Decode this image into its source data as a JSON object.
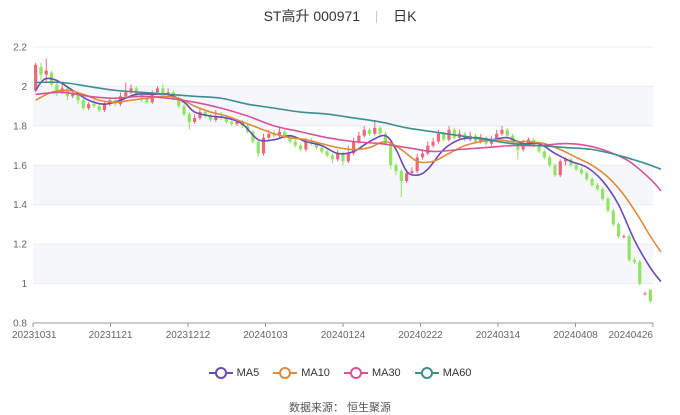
{
  "title": {
    "name": "ST高升 000971",
    "period": "日K"
  },
  "source": "数据来源： 恒生聚源",
  "colors": {
    "up": "#f0657a",
    "down": "#8ee55f",
    "grid": "#e8ecf4",
    "band": "#f5f7fb"
  },
  "chart_data": {
    "type": "candlestick",
    "ylim": [
      0.8,
      2.2
    ],
    "yticks": [
      "0.8",
      "1",
      "1.2",
      "1.4",
      "1.6",
      "1.8",
      "2",
      "2.2"
    ],
    "xticks": [
      "20231031",
      "20231121",
      "20231212",
      "20240103",
      "20240124",
      "20240222",
      "20240314",
      "20240408",
      "20240426"
    ],
    "legend_position": "bottom",
    "grid": true,
    "candles": [
      [
        1.98,
        2.11,
        2.12,
        1.97
      ],
      [
        2.1,
        2.06,
        2.12,
        2.03
      ],
      [
        2.06,
        2.08,
        2.14,
        2.02
      ],
      [
        2.07,
        2.01,
        2.08,
        2.0
      ],
      [
        2.01,
        1.97,
        2.02,
        1.95
      ],
      [
        1.97,
        1.99,
        2.01,
        1.96
      ],
      [
        1.99,
        1.95,
        2.0,
        1.93
      ],
      [
        1.95,
        1.96,
        1.98,
        1.94
      ],
      [
        1.96,
        1.93,
        1.97,
        1.91
      ],
      [
        1.93,
        1.89,
        1.94,
        1.88
      ],
      [
        1.89,
        1.91,
        1.92,
        1.88
      ],
      [
        1.91,
        1.9,
        1.94,
        1.89
      ],
      [
        1.9,
        1.88,
        1.91,
        1.87
      ],
      [
        1.88,
        1.91,
        1.92,
        1.87
      ],
      [
        1.91,
        1.93,
        1.94,
        1.9
      ],
      [
        1.93,
        1.91,
        1.94,
        1.9
      ],
      [
        1.91,
        1.95,
        1.97,
        1.9
      ],
      [
        1.95,
        1.97,
        2.02,
        1.94
      ],
      [
        1.97,
        1.99,
        2.01,
        1.96
      ],
      [
        1.99,
        1.96,
        2.0,
        1.95
      ],
      [
        1.96,
        1.94,
        1.97,
        1.92
      ],
      [
        1.94,
        1.92,
        1.95,
        1.91
      ],
      [
        1.92,
        1.97,
        1.98,
        1.91
      ],
      [
        1.97,
        1.99,
        2.0,
        1.96
      ],
      [
        1.99,
        1.96,
        2.01,
        1.95
      ],
      [
        1.96,
        1.97,
        1.99,
        1.95
      ],
      [
        1.97,
        1.94,
        1.98,
        1.93
      ],
      [
        1.94,
        1.9,
        1.95,
        1.89
      ],
      [
        1.9,
        1.86,
        1.91,
        1.85
      ],
      [
        1.86,
        1.82,
        1.87,
        1.78
      ],
      [
        1.82,
        1.84,
        1.86,
        1.81
      ],
      [
        1.84,
        1.87,
        1.89,
        1.83
      ],
      [
        1.87,
        1.85,
        1.88,
        1.84
      ],
      [
        1.85,
        1.83,
        1.86,
        1.82
      ],
      [
        1.83,
        1.85,
        1.88,
        1.82
      ],
      [
        1.85,
        1.84,
        1.87,
        1.83
      ],
      [
        1.84,
        1.82,
        1.85,
        1.81
      ],
      [
        1.82,
        1.81,
        1.84,
        1.8
      ],
      [
        1.81,
        1.82,
        1.83,
        1.8
      ],
      [
        1.82,
        1.8,
        1.83,
        1.79
      ],
      [
        1.8,
        1.77,
        1.81,
        1.76
      ],
      [
        1.77,
        1.72,
        1.78,
        1.71
      ],
      [
        1.72,
        1.66,
        1.73,
        1.64
      ],
      [
        1.66,
        1.74,
        1.76,
        1.65
      ],
      [
        1.74,
        1.76,
        1.78,
        1.73
      ],
      [
        1.76,
        1.75,
        1.78,
        1.74
      ],
      [
        1.75,
        1.77,
        1.79,
        1.74
      ],
      [
        1.77,
        1.74,
        1.78,
        1.73
      ],
      [
        1.74,
        1.72,
        1.75,
        1.71
      ],
      [
        1.72,
        1.7,
        1.73,
        1.69
      ],
      [
        1.7,
        1.68,
        1.71,
        1.67
      ],
      [
        1.68,
        1.72,
        1.74,
        1.67
      ],
      [
        1.72,
        1.71,
        1.74,
        1.7
      ],
      [
        1.71,
        1.69,
        1.72,
        1.68
      ],
      [
        1.69,
        1.67,
        1.7,
        1.66
      ],
      [
        1.67,
        1.65,
        1.68,
        1.64
      ],
      [
        1.65,
        1.63,
        1.66,
        1.61
      ],
      [
        1.63,
        1.66,
        1.68,
        1.62
      ],
      [
        1.66,
        1.62,
        1.67,
        1.6
      ],
      [
        1.62,
        1.66,
        1.7,
        1.61
      ],
      [
        1.66,
        1.72,
        1.74,
        1.65
      ],
      [
        1.72,
        1.75,
        1.77,
        1.71
      ],
      [
        1.75,
        1.78,
        1.8,
        1.74
      ],
      [
        1.78,
        1.76,
        1.79,
        1.75
      ],
      [
        1.76,
        1.79,
        1.83,
        1.75
      ],
      [
        1.79,
        1.76,
        1.8,
        1.74
      ],
      [
        1.76,
        1.71,
        1.77,
        1.7
      ],
      [
        1.71,
        1.6,
        1.72,
        1.58
      ],
      [
        1.6,
        1.57,
        1.61,
        1.55
      ],
      [
        1.57,
        1.52,
        1.58,
        1.44
      ],
      [
        1.52,
        1.56,
        1.58,
        1.51
      ],
      [
        1.56,
        1.57,
        1.59,
        1.55
      ],
      [
        1.57,
        1.64,
        1.66,
        1.56
      ],
      [
        1.64,
        1.66,
        1.68,
        1.63
      ],
      [
        1.66,
        1.7,
        1.72,
        1.65
      ],
      [
        1.7,
        1.72,
        1.74,
        1.69
      ],
      [
        1.72,
        1.76,
        1.78,
        1.71
      ],
      [
        1.76,
        1.73,
        1.77,
        1.72
      ],
      [
        1.73,
        1.78,
        1.8,
        1.72
      ],
      [
        1.78,
        1.74,
        1.79,
        1.73
      ],
      [
        1.74,
        1.76,
        1.78,
        1.73
      ],
      [
        1.76,
        1.73,
        1.77,
        1.72
      ],
      [
        1.73,
        1.75,
        1.77,
        1.72
      ],
      [
        1.75,
        1.72,
        1.76,
        1.71
      ],
      [
        1.72,
        1.74,
        1.76,
        1.71
      ],
      [
        1.74,
        1.71,
        1.75,
        1.7
      ],
      [
        1.71,
        1.73,
        1.75,
        1.7
      ],
      [
        1.73,
        1.76,
        1.78,
        1.72
      ],
      [
        1.76,
        1.78,
        1.8,
        1.75
      ],
      [
        1.78,
        1.75,
        1.79,
        1.74
      ],
      [
        1.75,
        1.72,
        1.76,
        1.71
      ],
      [
        1.72,
        1.68,
        1.73,
        1.63
      ],
      [
        1.68,
        1.71,
        1.73,
        1.67
      ],
      [
        1.71,
        1.73,
        1.74,
        1.7
      ],
      [
        1.73,
        1.7,
        1.74,
        1.69
      ],
      [
        1.7,
        1.67,
        1.71,
        1.66
      ],
      [
        1.67,
        1.64,
        1.68,
        1.63
      ],
      [
        1.64,
        1.6,
        1.65,
        1.59
      ],
      [
        1.6,
        1.55,
        1.61,
        1.54
      ],
      [
        1.55,
        1.62,
        1.63,
        1.54
      ],
      [
        1.62,
        1.63,
        1.64,
        1.6
      ],
      [
        1.63,
        1.6,
        1.64,
        1.59
      ],
      [
        1.6,
        1.58,
        1.61,
        1.57
      ],
      [
        1.58,
        1.56,
        1.59,
        1.55
      ],
      [
        1.56,
        1.53,
        1.57,
        1.52
      ],
      [
        1.53,
        1.5,
        1.54,
        1.49
      ],
      [
        1.5,
        1.48,
        1.51,
        1.47
      ],
      [
        1.48,
        1.43,
        1.49,
        1.42
      ],
      [
        1.43,
        1.37,
        1.44,
        1.36
      ],
      [
        1.37,
        1.3,
        1.38,
        1.29
      ],
      [
        1.3,
        1.24,
        1.31,
        1.23
      ],
      [
        1.24,
        1.24,
        1.25,
        1.23
      ],
      [
        1.24,
        1.12,
        1.25,
        1.11
      ],
      [
        1.12,
        1.11,
        1.13,
        1.1
      ],
      [
        1.11,
        1.0,
        1.12,
        0.99
      ],
      [
        0.95,
        0.95,
        0.96,
        0.94
      ],
      [
        0.97,
        0.91,
        0.97,
        0.9
      ]
    ],
    "series": [
      {
        "name": "MA5",
        "color": "#6c4ab6",
        "values": [
          [
            0,
            1.98
          ],
          [
            1,
            2.02
          ],
          [
            2,
            2.04
          ],
          [
            4,
            2.03
          ],
          [
            7,
            1.98
          ],
          [
            10,
            1.93
          ],
          [
            13,
            1.91
          ],
          [
            16,
            1.93
          ],
          [
            19,
            1.96
          ],
          [
            22,
            1.96
          ],
          [
            25,
            1.96
          ],
          [
            28,
            1.92
          ],
          [
            30,
            1.87
          ],
          [
            33,
            1.85
          ],
          [
            36,
            1.84
          ],
          [
            39,
            1.81
          ],
          [
            42,
            1.73
          ],
          [
            45,
            1.73
          ],
          [
            48,
            1.75
          ],
          [
            51,
            1.72
          ],
          [
            54,
            1.7
          ],
          [
            57,
            1.66
          ],
          [
            60,
            1.67
          ],
          [
            63,
            1.72
          ],
          [
            66,
            1.75
          ],
          [
            68,
            1.68
          ],
          [
            70,
            1.57
          ],
          [
            72,
            1.55
          ],
          [
            74,
            1.58
          ],
          [
            77,
            1.68
          ],
          [
            80,
            1.73
          ],
          [
            83,
            1.74
          ],
          [
            86,
            1.73
          ],
          [
            89,
            1.74
          ],
          [
            92,
            1.71
          ],
          [
            95,
            1.71
          ],
          [
            98,
            1.66
          ],
          [
            101,
            1.62
          ],
          [
            104,
            1.59
          ],
          [
            107,
            1.52
          ],
          [
            110,
            1.4
          ],
          [
            113,
            1.22
          ],
          [
            116,
            1.08
          ],
          [
            118,
            1.01
          ]
        ]
      },
      {
        "name": "MA10",
        "color": "#e08a3c",
        "values": [
          [
            0,
            1.93
          ],
          [
            3,
            1.97
          ],
          [
            6,
            1.98
          ],
          [
            9,
            1.96
          ],
          [
            12,
            1.93
          ],
          [
            15,
            1.92
          ],
          [
            18,
            1.93
          ],
          [
            21,
            1.94
          ],
          [
            24,
            1.95
          ],
          [
            27,
            1.94
          ],
          [
            30,
            1.9
          ],
          [
            33,
            1.87
          ],
          [
            36,
            1.85
          ],
          [
            39,
            1.82
          ],
          [
            42,
            1.79
          ],
          [
            45,
            1.76
          ],
          [
            48,
            1.74
          ],
          [
            51,
            1.73
          ],
          [
            54,
            1.71
          ],
          [
            57,
            1.69
          ],
          [
            60,
            1.68
          ],
          [
            63,
            1.69
          ],
          [
            66,
            1.72
          ],
          [
            69,
            1.68
          ],
          [
            72,
            1.62
          ],
          [
            75,
            1.62
          ],
          [
            78,
            1.66
          ],
          [
            81,
            1.7
          ],
          [
            84,
            1.72
          ],
          [
            87,
            1.73
          ],
          [
            90,
            1.72
          ],
          [
            93,
            1.72
          ],
          [
            96,
            1.71
          ],
          [
            99,
            1.68
          ],
          [
            102,
            1.64
          ],
          [
            105,
            1.6
          ],
          [
            108,
            1.54
          ],
          [
            111,
            1.45
          ],
          [
            114,
            1.33
          ],
          [
            116,
            1.24
          ],
          [
            118,
            1.16
          ]
        ]
      },
      {
        "name": "MA30",
        "color": "#d6539a",
        "values": [
          [
            0,
            1.96
          ],
          [
            5,
            1.97
          ],
          [
            10,
            1.95
          ],
          [
            15,
            1.94
          ],
          [
            20,
            1.95
          ],
          [
            25,
            1.94
          ],
          [
            30,
            1.92
          ],
          [
            35,
            1.89
          ],
          [
            40,
            1.85
          ],
          [
            45,
            1.8
          ],
          [
            50,
            1.77
          ],
          [
            55,
            1.74
          ],
          [
            60,
            1.72
          ],
          [
            65,
            1.71
          ],
          [
            70,
            1.69
          ],
          [
            75,
            1.67
          ],
          [
            80,
            1.68
          ],
          [
            85,
            1.69
          ],
          [
            90,
            1.7
          ],
          [
            95,
            1.7
          ],
          [
            100,
            1.71
          ],
          [
            104,
            1.7
          ],
          [
            108,
            1.67
          ],
          [
            112,
            1.62
          ],
          [
            116,
            1.53
          ],
          [
            118,
            1.47
          ]
        ]
      },
      {
        "name": "MA60",
        "color": "#3b8f8c",
        "values": [
          [
            0,
            2.02
          ],
          [
            5,
            2.02
          ],
          [
            10,
            2.0
          ],
          [
            15,
            1.98
          ],
          [
            20,
            1.97
          ],
          [
            25,
            1.96
          ],
          [
            30,
            1.95
          ],
          [
            35,
            1.94
          ],
          [
            40,
            1.91
          ],
          [
            45,
            1.89
          ],
          [
            50,
            1.87
          ],
          [
            55,
            1.86
          ],
          [
            60,
            1.84
          ],
          [
            65,
            1.82
          ],
          [
            70,
            1.79
          ],
          [
            75,
            1.77
          ],
          [
            80,
            1.75
          ],
          [
            85,
            1.73
          ],
          [
            90,
            1.71
          ],
          [
            95,
            1.7
          ],
          [
            100,
            1.69
          ],
          [
            105,
            1.68
          ],
          [
            110,
            1.65
          ],
          [
            115,
            1.61
          ],
          [
            118,
            1.58
          ]
        ]
      }
    ]
  }
}
